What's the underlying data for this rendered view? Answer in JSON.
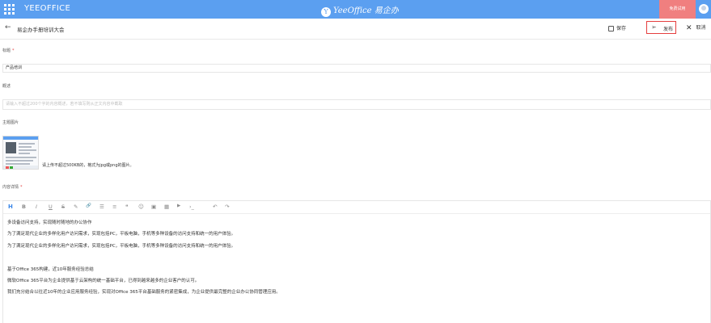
{
  "header": {
    "brand": "YEEOFFICE",
    "logo_text": "YeeOffice 易企办",
    "trial_label": "免费试用"
  },
  "pagebar": {
    "title": "易企办手册培训大会",
    "save_label": "保存",
    "publish_label": "发布",
    "cancel_label": "取消"
  },
  "form": {
    "title_label": "标题",
    "title_value": "产品培训",
    "summary_label": "概述",
    "summary_placeholder": "请输入不超过200个字的内容概述，若不填写则从正文内容中截取",
    "image_label": "主题图片",
    "image_hint": "请上传不超过500KB的，格式为jpg或png的图片。",
    "content_label": "内容详情"
  },
  "editor": {
    "toolbar": [
      {
        "name": "heading",
        "glyph": "H"
      },
      {
        "name": "bold",
        "glyph": "B"
      },
      {
        "name": "italic",
        "glyph": "I"
      },
      {
        "name": "underline",
        "glyph": "U"
      },
      {
        "name": "strikethrough",
        "glyph": "S"
      },
      {
        "name": "color",
        "glyph": "✎"
      },
      {
        "name": "link",
        "glyph": "🔗"
      },
      {
        "name": "unordered-list",
        "glyph": "☰"
      },
      {
        "name": "ordered-list",
        "glyph": "≡"
      },
      {
        "name": "quote",
        "glyph": "❝"
      },
      {
        "name": "emoji",
        "glyph": "☺"
      },
      {
        "name": "image",
        "glyph": "▣"
      },
      {
        "name": "table",
        "glyph": "▦"
      },
      {
        "name": "video",
        "glyph": "▶"
      },
      {
        "name": "code",
        "glyph": "›_"
      },
      {
        "name": "undo",
        "glyph": "↶"
      },
      {
        "name": "redo",
        "glyph": "↷"
      }
    ],
    "paragraphs": [
      "多设备访问支持，实现随时随地的办公协作",
      "为了满足现代企业的多样化用户访问需求，实现包括PC，平板电脑，手机等多种设备的访问支持和统一的用户体验。",
      "为了满足现代企业的多样化用户访问需求，实现包括PC，平板电脑，手机等多种设备的访问支持和统一的用户体验。",
      "基于Office 365构建，近10年服务经验总结",
      "微软Office 365平台为企业提供基于云架构的统一基础平台，已得到越来越多的企业客户的认可。",
      "我们充分结合以往近10年的企业应用服务经验，实现对Office 365平台基础服务的紧密集成，为企业提供最完整的企业办公协同管理应用。"
    ]
  }
}
